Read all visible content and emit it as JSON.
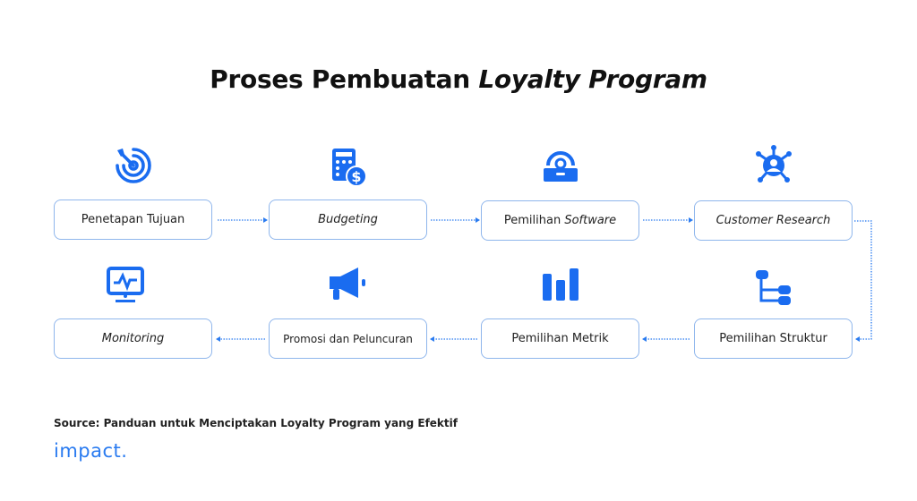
{
  "title": {
    "prefix": "Proses Pembuatan ",
    "italic": "Loyalty Program"
  },
  "colors": {
    "accent": "#1a6cf0",
    "box_border": "#8fb6ec",
    "connector": "#2a7bf0",
    "logo": "#2a7bf0"
  },
  "steps": [
    {
      "order": 1,
      "plain": "Penetapan Tujuan",
      "italic": "",
      "icon": "target-icon"
    },
    {
      "order": 2,
      "plain": "",
      "italic": "Budgeting",
      "icon": "calculator-dollar-icon"
    },
    {
      "order": 3,
      "plain": "Pemilihan ",
      "italic": "Software",
      "icon": "lock-icon"
    },
    {
      "order": 4,
      "plain": "",
      "italic": "Customer Research",
      "icon": "customer-network-icon"
    },
    {
      "order": 5,
      "plain": "Pemilihan Struktur",
      "italic": "",
      "icon": "structure-tree-icon"
    },
    {
      "order": 6,
      "plain": "Pemilihan Metrik",
      "italic": "",
      "icon": "bar-chart-icon"
    },
    {
      "order": 7,
      "plain": "Promosi dan Peluncuran",
      "italic": "",
      "icon": "megaphone-icon"
    },
    {
      "order": 8,
      "plain": "",
      "italic": "Monitoring",
      "icon": "monitor-pulse-icon"
    }
  ],
  "footer": {
    "source": "Source: Panduan untuk Menciptakan Loyalty Program yang Efektif",
    "logo": "impact."
  }
}
